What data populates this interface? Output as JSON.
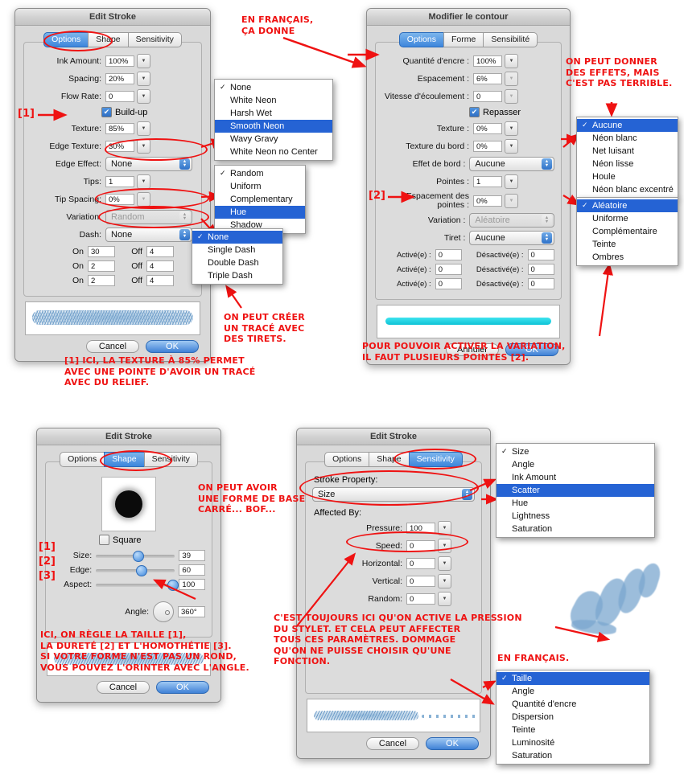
{
  "dialogs": {
    "edit_stroke_options": {
      "title": "Edit Stroke",
      "tabs": [
        "Options",
        "Shape",
        "Sensitivity"
      ],
      "active_tab": "Options",
      "fields": [
        {
          "label": "Ink Amount:",
          "value": "100%"
        },
        {
          "label": "Spacing:",
          "value": "20%"
        },
        {
          "label": "Flow Rate:",
          "value": "0"
        }
      ],
      "checkbox": {
        "label": "Build-up",
        "checked": true
      },
      "fields2": [
        {
          "label": "Texture:",
          "value": "85%"
        },
        {
          "label": "Edge Texture:",
          "value": "30%"
        }
      ],
      "edge_effect": {
        "label": "Edge Effect:",
        "value": "None"
      },
      "tips": {
        "label": "Tips:",
        "value": "1"
      },
      "tip_spacing": {
        "label": "Tip Spacing:",
        "value": "0%"
      },
      "variation": {
        "label": "Variation:",
        "value": "Random"
      },
      "dash": {
        "label": "Dash:",
        "value": "None"
      },
      "dash_rows": [
        {
          "on_label": "On",
          "on": "30",
          "off_label": "Off",
          "off": "4"
        },
        {
          "on_label": "On",
          "on": "2",
          "off_label": "Off",
          "off": "4"
        },
        {
          "on_label": "On",
          "on": "2",
          "off_label": "Off",
          "off": "4"
        }
      ],
      "cancel": "Cancel",
      "ok": "OK"
    },
    "modifier_contour": {
      "title": "Modifier le contour",
      "tabs": [
        "Options",
        "Forme",
        "Sensibilité"
      ],
      "active_tab": "Options",
      "fields": [
        {
          "label": "Quantité d'encre :",
          "value": "100%"
        },
        {
          "label": "Espacement :",
          "value": "6%"
        },
        {
          "label": "Vitesse d'écoulement :",
          "value": "0"
        }
      ],
      "checkbox": {
        "label": "Repasser",
        "checked": true
      },
      "fields2": [
        {
          "label": "Texture :",
          "value": "0%"
        },
        {
          "label": "Texture du bord :",
          "value": "0%"
        }
      ],
      "edge_effect": {
        "label": "Effet de bord :",
        "value": "Aucune"
      },
      "tips": {
        "label": "Pointes :",
        "value": "1"
      },
      "tip_spacing": {
        "label": "Espacement des pointes :",
        "value": "0%"
      },
      "variation": {
        "label": "Variation :",
        "value": "Aléatoire"
      },
      "dash": {
        "label": "Tiret :",
        "value": "Aucune"
      },
      "dash_rows": [
        {
          "on_label": "Activé(e) :",
          "on": "0",
          "off_label": "Désactivé(e) :",
          "off": "0"
        },
        {
          "on_label": "Activé(e) :",
          "on": "0",
          "off_label": "Désactivé(e) :",
          "off": "0"
        },
        {
          "on_label": "Activé(e) :",
          "on": "0",
          "off_label": "Désactivé(e) :",
          "off": "0"
        }
      ],
      "cancel": "Annuler",
      "ok": "OK"
    },
    "edit_stroke_shape": {
      "title": "Edit Stroke",
      "tabs": [
        "Options",
        "Shape",
        "Sensitivity"
      ],
      "active_tab": "Shape",
      "square_checkbox": {
        "label": "Square",
        "checked": false
      },
      "sliders": [
        {
          "tag": "[1]",
          "label": "Size:",
          "value": "39",
          "pct": 47
        },
        {
          "tag": "[2]",
          "label": "Edge:",
          "value": "60",
          "pct": 51
        },
        {
          "tag": "[3]",
          "label": "Aspect:",
          "value": "100",
          "pct": 93
        }
      ],
      "angle": {
        "label": "Angle:",
        "value": "360°"
      },
      "cancel": "Cancel",
      "ok": "OK"
    },
    "edit_stroke_sensitivity": {
      "title": "Edit Stroke",
      "tabs": [
        "Options",
        "Shape",
        "Sensitivity"
      ],
      "active_tab": "Sensitivity",
      "stroke_property_label": "Stroke Property:",
      "stroke_property_value": "Size",
      "affected_by_label": "Affected By:",
      "affected": [
        {
          "label": "Pressure:",
          "value": "100"
        },
        {
          "label": "Speed:",
          "value": "0"
        },
        {
          "label": "Horizontal:",
          "value": "0"
        },
        {
          "label": "Vertical:",
          "value": "0"
        },
        {
          "label": "Random:",
          "value": "0"
        }
      ],
      "cancel": "Cancel",
      "ok": "OK"
    }
  },
  "menus": {
    "edge_effect_en": {
      "items": [
        "None",
        "White Neon",
        "Harsh Wet",
        "Smooth Neon",
        "Wavy Gravy",
        "White Neon no Center"
      ],
      "checked": "None",
      "highlighted": "Smooth Neon"
    },
    "variation_en": {
      "items": [
        "Random",
        "Uniform",
        "Complementary",
        "Hue",
        "Shadow"
      ],
      "checked": "Random",
      "highlighted": "Hue"
    },
    "dash_en": {
      "items": [
        "None",
        "Single Dash",
        "Double Dash",
        "Triple Dash"
      ],
      "checked": "",
      "highlighted": "None"
    },
    "edge_effect_fr": {
      "items": [
        "Aucune",
        "Néon blanc",
        "Net luisant",
        "Néon lisse",
        "Houle",
        "Néon blanc excentré"
      ],
      "checked": "Aucune",
      "highlighted": "Aucune"
    },
    "variation_fr": {
      "items": [
        "Aléatoire",
        "Uniforme",
        "Complémentaire",
        "Teinte",
        "Ombres"
      ],
      "checked": "Aléatoire",
      "highlighted": "Aléatoire"
    },
    "stroke_property_en": {
      "items": [
        "Size",
        "Angle",
        "Ink Amount",
        "Scatter",
        "Hue",
        "Lightness",
        "Saturation"
      ],
      "checked": "Size",
      "highlighted": "Scatter"
    },
    "stroke_property_fr": {
      "items": [
        "Taille",
        "Angle",
        "Quantité d'encre",
        "Dispersion",
        "Teinte",
        "Luminosité",
        "Saturation"
      ],
      "checked": "Taille",
      "highlighted": "Taille"
    }
  },
  "annotations": {
    "a1": "En français,\nça donne",
    "a2": "On peut donner\ndes effets, mais\nc'est pas terrible.",
    "a3": "On peut créer\nun tracé avec\ndes tirets.",
    "a4": "[1] Ici, la texture à 85% permet\navec une pointe d'avoir un tracé\navec du relief.",
    "a5": "Pour pouvoir activer la variation,\nil faut plusieurs pointes [2].",
    "a6": "On peut avoir\nune forme de base\ncarré... Bof...",
    "a7": "Ici, on règle la taille [1],\nla dureté [2] et l'homothétie [3].\nSi votre forme n'est pas un rond,\nvous pouvez l'orinter avec l'angle.",
    "a8": "C'est toujours ici qu'on active la pression\ndu stylet. Et cela peut affecter\ntous ces paramètres. Dommage\nqu'on ne puisse choisir qu'une\nfonction.",
    "a9": "En français.",
    "tag1": "[1]",
    "tag2": "[2]"
  },
  "colors": {
    "accent": "#2563d4",
    "annotation": "#ef1212",
    "brush": "#7ba7cf",
    "cyan_preview": "#1ad4e0"
  }
}
